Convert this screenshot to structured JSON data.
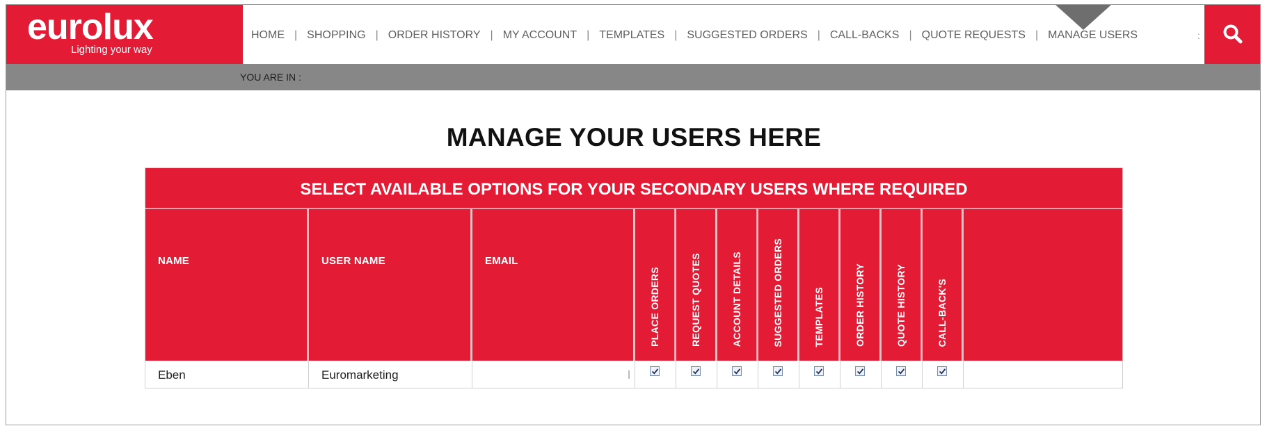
{
  "brand": {
    "name": "eurolux",
    "tagline": "Lighting your way",
    "color": "#e41b35"
  },
  "nav": {
    "items": [
      "HOME",
      "SHOPPING",
      "ORDER HISTORY",
      "MY ACCOUNT",
      "TEMPLATES",
      "SUGGESTED ORDERS",
      "CALL-BACKS",
      "QUOTE REQUESTS",
      "MANAGE USERS"
    ],
    "overflow": ":"
  },
  "search": {
    "icon": "search-icon"
  },
  "breadcrumb": {
    "label": "YOU ARE IN :"
  },
  "page": {
    "title": "MANAGE YOUR USERS HERE"
  },
  "table": {
    "banner": "SELECT AVAILABLE OPTIONS FOR YOUR SECONDARY USERS WHERE REQUIRED",
    "columns": {
      "name": "NAME",
      "username": "USER NAME",
      "email": "EMAIL",
      "permissions": [
        "PLACE ORDERS",
        "REQUEST QUOTES",
        "ACCOUNT DETAILS",
        "SUGGESTED ORDERS",
        "TEMPLATES",
        "ORDER HISTORY",
        "QUOTE HISTORY",
        "CALL-BACK'S"
      ]
    },
    "rows": [
      {
        "name": "Eben",
        "username": "Euromarketing",
        "email": "",
        "permissions": [
          true,
          true,
          true,
          true,
          true,
          true,
          true,
          true
        ]
      }
    ]
  }
}
